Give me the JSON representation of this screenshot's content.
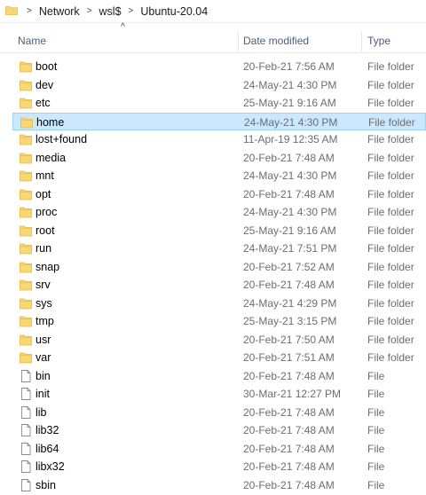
{
  "breadcrumb": [
    "Network",
    "wsl$",
    "Ubuntu-20.04"
  ],
  "columns": {
    "name": "Name",
    "date": "Date modified",
    "type": "Type"
  },
  "colors": {
    "folder": "#f8d775",
    "folder_dark": "#e8b64a",
    "selection": "#cce8ff",
    "selection_border": "#99d1ff",
    "header_text": "#4c607a",
    "meta_text": "#6d6d6d"
  },
  "rows": [
    {
      "name": "boot",
      "date": "20-Feb-21 7:56 AM",
      "type": "File folder",
      "icon": "folder-icon"
    },
    {
      "name": "dev",
      "date": "24-May-21 4:30 PM",
      "type": "File folder",
      "icon": "folder-icon"
    },
    {
      "name": "etc",
      "date": "25-May-21 9:16 AM",
      "type": "File folder",
      "icon": "folder-icon"
    },
    {
      "name": "home",
      "date": "24-May-21 4:30 PM",
      "type": "File folder",
      "icon": "folder-icon",
      "selected": true
    },
    {
      "name": "lost+found",
      "date": "11-Apr-19 12:35 AM",
      "type": "File folder",
      "icon": "folder-icon"
    },
    {
      "name": "media",
      "date": "20-Feb-21 7:48 AM",
      "type": "File folder",
      "icon": "folder-icon"
    },
    {
      "name": "mnt",
      "date": "24-May-21 4:30 PM",
      "type": "File folder",
      "icon": "folder-icon"
    },
    {
      "name": "opt",
      "date": "20-Feb-21 7:48 AM",
      "type": "File folder",
      "icon": "folder-icon"
    },
    {
      "name": "proc",
      "date": "24-May-21 4:30 PM",
      "type": "File folder",
      "icon": "folder-icon"
    },
    {
      "name": "root",
      "date": "25-May-21 9:16 AM",
      "type": "File folder",
      "icon": "folder-icon"
    },
    {
      "name": "run",
      "date": "24-May-21 7:51 PM",
      "type": "File folder",
      "icon": "folder-icon"
    },
    {
      "name": "snap",
      "date": "20-Feb-21 7:52 AM",
      "type": "File folder",
      "icon": "folder-icon"
    },
    {
      "name": "srv",
      "date": "20-Feb-21 7:48 AM",
      "type": "File folder",
      "icon": "folder-icon"
    },
    {
      "name": "sys",
      "date": "24-May-21 4:29 PM",
      "type": "File folder",
      "icon": "folder-icon"
    },
    {
      "name": "tmp",
      "date": "25-May-21 3:15 PM",
      "type": "File folder",
      "icon": "folder-icon"
    },
    {
      "name": "usr",
      "date": "20-Feb-21 7:50 AM",
      "type": "File folder",
      "icon": "folder-icon"
    },
    {
      "name": "var",
      "date": "20-Feb-21 7:51 AM",
      "type": "File folder",
      "icon": "folder-icon"
    },
    {
      "name": "bin",
      "date": "20-Feb-21 7:48 AM",
      "type": "File",
      "icon": "file-icon"
    },
    {
      "name": "init",
      "date": "30-Mar-21 12:27 PM",
      "type": "File",
      "icon": "file-icon"
    },
    {
      "name": "lib",
      "date": "20-Feb-21 7:48 AM",
      "type": "File",
      "icon": "file-icon"
    },
    {
      "name": "lib32",
      "date": "20-Feb-21 7:48 AM",
      "type": "File",
      "icon": "file-icon"
    },
    {
      "name": "lib64",
      "date": "20-Feb-21 7:48 AM",
      "type": "File",
      "icon": "file-icon"
    },
    {
      "name": "libx32",
      "date": "20-Feb-21 7:48 AM",
      "type": "File",
      "icon": "file-icon"
    },
    {
      "name": "sbin",
      "date": "20-Feb-21 7:48 AM",
      "type": "File",
      "icon": "file-icon"
    }
  ]
}
